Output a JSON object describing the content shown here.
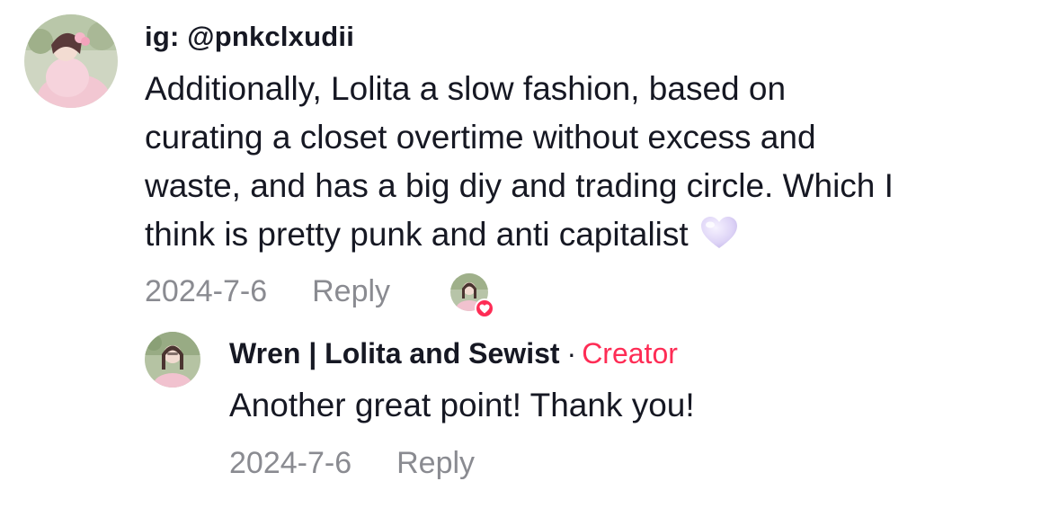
{
  "comment": {
    "username": "ig: @pnkclxudii",
    "text_lines": [
      "Additionally, Lolita a slow fashion, based on",
      "curating a closet overtime without excess and",
      "waste, and has a big diy and trading circle. Which I",
      "think is pretty punk and anti capitalist"
    ],
    "emoji": "white-heart-icon",
    "date": "2024-7-6",
    "reply_label": "Reply",
    "creator_liked": true
  },
  "reply": {
    "author": "Wren | Lolita and Sewist",
    "separator": "·",
    "badge": "Creator",
    "text": "Another great point! Thank you!",
    "date": "2024-7-6",
    "reply_label": "Reply"
  },
  "colors": {
    "text": "#161823",
    "meta": "#8a8b91",
    "creator_accent": "#fe2c55",
    "heart": "#e6defa"
  }
}
